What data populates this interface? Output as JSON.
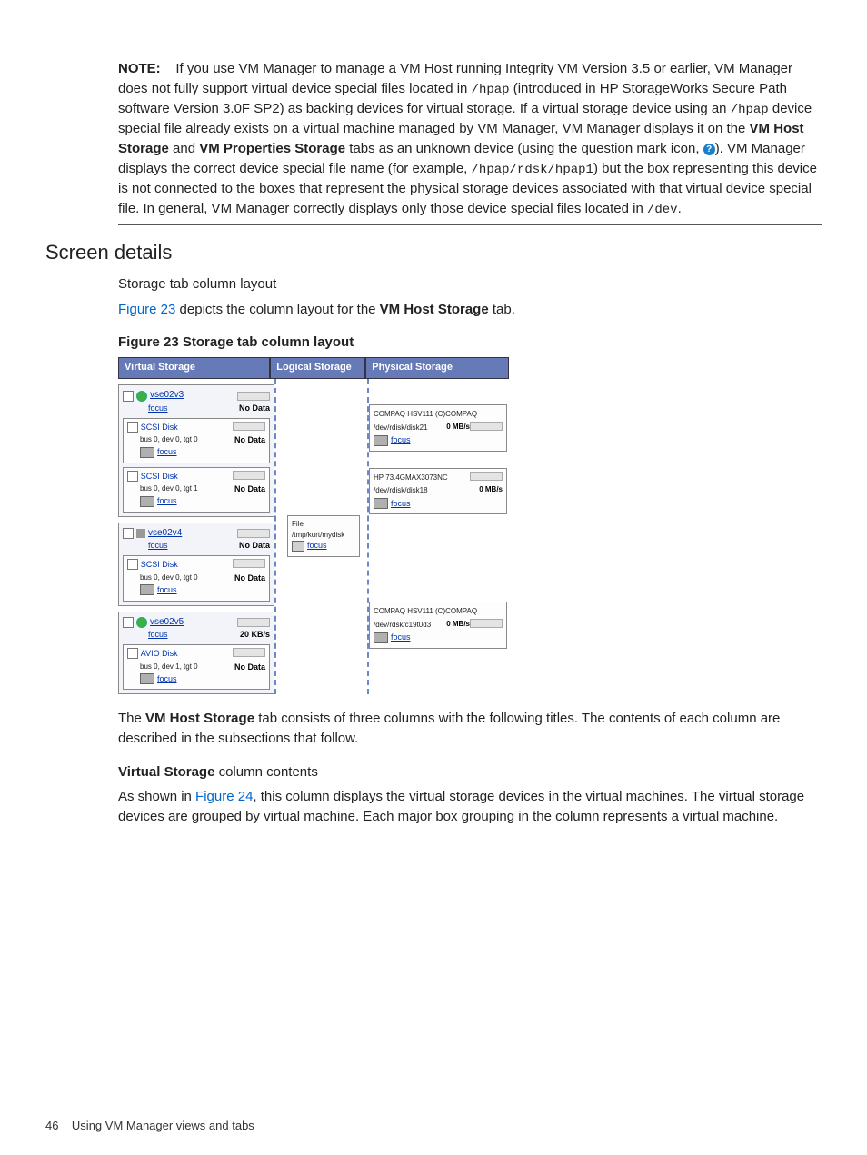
{
  "note": {
    "label": "NOTE:",
    "text_a": "If you use VM Manager to manage a VM Host running Integrity VM Version 3.5 or earlier, VM Manager does not fully support virtual device special files located in ",
    "path1": "/hpap",
    "text_b": " (introduced in HP StorageWorks Secure Path software Version 3.0F SP2) as backing devices for virtual storage. If a virtual storage device using an ",
    "path2": "/hpap",
    "text_c": " device special file already exists on a virtual machine managed by VM Manager, VM Manager displays it on the ",
    "bold1": "VM Host Storage",
    "text_d": " and ",
    "bold2": "VM Properties Storage",
    "text_e": " tabs as an unknown device (using the question mark icon, ",
    "text_f": "). VM Manager displays the correct device special file name (for example, ",
    "path3": "/hpap/rdsk/hpap1",
    "text_g": ") but the box representing this device is not connected to the boxes that represent the physical storage devices associated with that virtual device special file. In general, VM Manager correctly displays only those device special files located in ",
    "path4": "/dev",
    "text_h": "."
  },
  "screen_details_heading": "Screen details",
  "layout_title": "Storage tab column layout",
  "fig_intro_a": "Figure 23",
  "fig_intro_b": " depicts the column layout for the ",
  "fig_intro_bold": "VM Host Storage",
  "fig_intro_c": " tab.",
  "figure_caption": "Figure 23 Storage tab column layout",
  "fig23": {
    "headers": {
      "virtual": "Virtual Storage",
      "logical": "Logical Storage",
      "physical": "Physical Storage"
    },
    "focus": "focus",
    "nodata": "No Data",
    "vm1": {
      "name": "vse02v3",
      "d1_title": "SCSI Disk",
      "d1_sub": "bus 0, dev 0, tgt 0",
      "d2_title": "SCSI Disk",
      "d2_sub": "bus 0, dev 0, tgt 1"
    },
    "vm2": {
      "name": "vse02v4",
      "d1_title": "SCSI Disk",
      "d1_sub": "bus 0, dev 0, tgt 0"
    },
    "vm3": {
      "name": "vse02v5",
      "rate": "20 KB/s",
      "d1_title": "AVIO Disk",
      "d1_sub": "bus 0, dev 1, tgt 0"
    },
    "file": {
      "label": "File",
      "path": "/tmp/kurt/mydisk"
    },
    "phys1": {
      "title": "COMPAQ HSV111 (C)COMPAQ",
      "path": "/dev/rdisk/disk21",
      "rate": "0 MB/s"
    },
    "phys2": {
      "title": "HP 73.4GMAX3073NC",
      "path": "/dev/rdisk/disk18",
      "rate": "0 MB/s"
    },
    "phys3": {
      "title": "COMPAQ HSV111 (C)COMPAQ",
      "path": "/dev/rdsk/c19t0d3",
      "rate": "0 MB/s"
    }
  },
  "after_fig_a": "The ",
  "after_fig_bold": "VM Host Storage",
  "after_fig_b": " tab consists of three columns with the following titles. The contents of each column are described in the subsections that follow.",
  "vsc_bold": "Virtual Storage",
  "vsc_tail": " column contents",
  "vsc_para_a": "As shown in ",
  "vsc_link": "Figure 24",
  "vsc_para_b": ", this column displays the virtual storage devices in the virtual machines. The virtual storage devices are grouped by virtual machine. Each major box grouping in the column represents a virtual machine.",
  "footer": {
    "page": "46",
    "title": "Using VM Manager views and tabs"
  }
}
